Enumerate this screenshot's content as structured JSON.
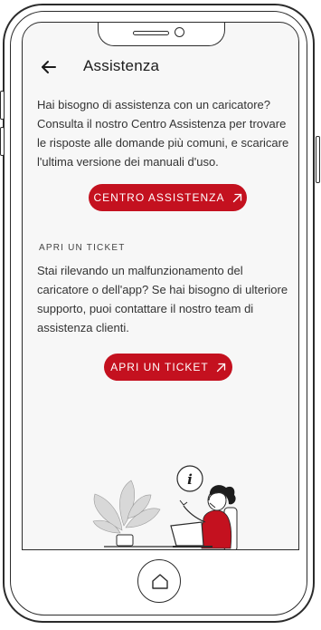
{
  "header": {
    "title": "Assistenza",
    "back_icon": "arrow-left-icon"
  },
  "intro": {
    "text": "Hai bisogno di assistenza con un caricatore? Consulta il nostro Centro Assistenza per trovare le risposte alle domande più comuni, e scaricare l'ultima versione dei manuali d'uso."
  },
  "help_center_button": {
    "label": "CENTRO ASSISTENZA",
    "icon": "arrow-up-right-icon"
  },
  "ticket_section": {
    "label": "Apri un ticket",
    "text": "Stai rilevando un malfunzionamento del caricatore o dell'app? Se hai bisogno di ulteriore supporto, puoi contattare il nostro team di assistenza clienti."
  },
  "ticket_button": {
    "label": "APRI UN TICKET",
    "icon": "arrow-up-right-icon"
  },
  "home_button": {
    "icon": "home-icon"
  },
  "colors": {
    "accent": "#c4111f",
    "background": "#f7f7f7",
    "text": "#333333"
  }
}
